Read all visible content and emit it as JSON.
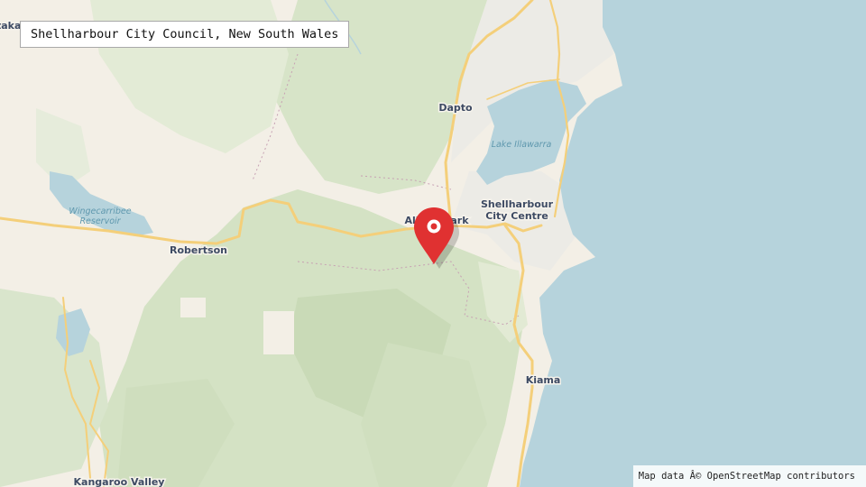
{
  "title": "Shellharbour City Council, New South Wales",
  "attribution": "Map data Â© OpenStreetMap contributors",
  "places": {
    "partial_top_left": "takago",
    "dapto": "Dapto",
    "shellharbour_line1": "Shellharbour",
    "shellharbour_line2": "City Centre",
    "robertson": "Robertson",
    "albion_park": "Albion Park",
    "kiama": "Kiama",
    "kangaroo_valley": "Kangaroo Valley"
  },
  "water": {
    "lake_illawarra": "Lake Illawarra",
    "wingecarribee_line1": "Wingecarribee",
    "wingecarribee_line2": "Reservoir"
  },
  "colors": {
    "land": "#f3efe6",
    "forest": "#d9e6cb",
    "forest_dark": "#c9dcb8",
    "sea": "#b6d3dc",
    "road": "#f4cf7a",
    "marker": "#e03131"
  },
  "marker_icon": "map-pin-icon"
}
